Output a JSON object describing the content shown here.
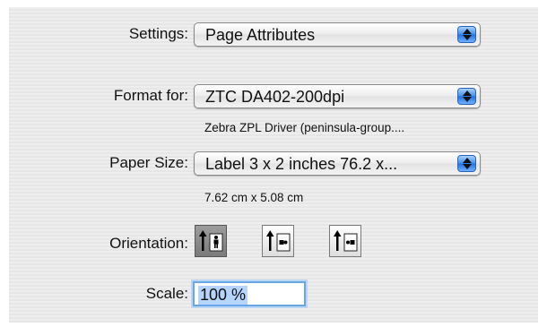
{
  "settings": {
    "label": "Settings:",
    "value": "Page Attributes"
  },
  "format_for": {
    "label": "Format for:",
    "value": "ZTC DA402-200dpi",
    "driver_info": "Zebra ZPL Driver (peninsula-group...."
  },
  "paper_size": {
    "label": "Paper Size:",
    "value": "Label 3 x 2 inches 76.2 x...",
    "dimensions": "7.62 cm x 5.08 cm"
  },
  "orientation": {
    "label": "Orientation:",
    "options": [
      {
        "icon": "portrait-orientation-icon",
        "selected": true
      },
      {
        "icon": "landscape-left-orientation-icon",
        "selected": false
      },
      {
        "icon": "landscape-right-orientation-icon",
        "selected": false
      }
    ]
  },
  "scale": {
    "label": "Scale:",
    "value": "100 %"
  }
}
